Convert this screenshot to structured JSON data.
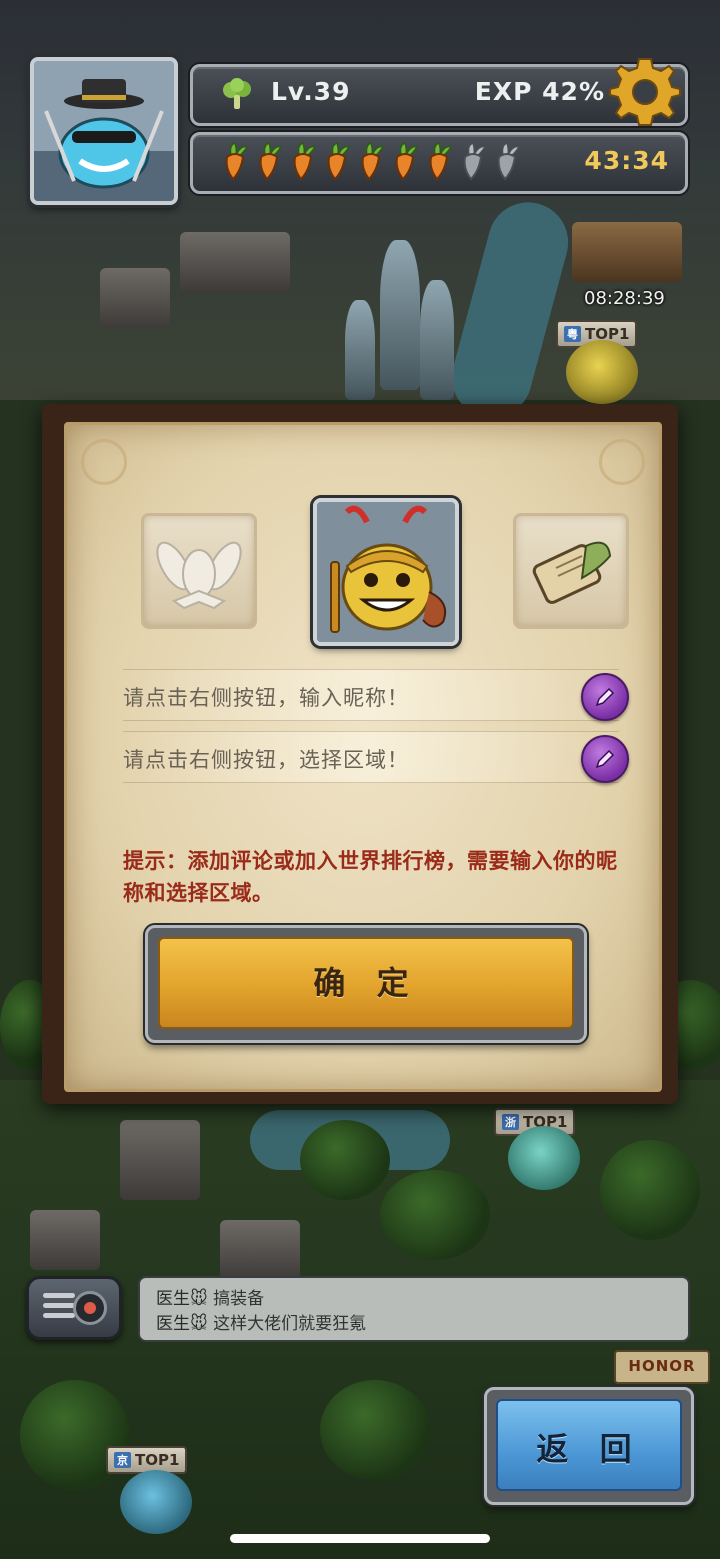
{
  "hud": {
    "level": "Lv.39",
    "exp": "EXP 42%",
    "stamina_full": 7,
    "stamina_total": 9,
    "timer": "43:34"
  },
  "map": {
    "event_timer": "08:28:39",
    "top_badges": [
      {
        "province": "粤",
        "label": "TOP1"
      },
      {
        "province": "浙",
        "label": "TOP1"
      },
      {
        "province": "京",
        "label": "TOP1"
      }
    ],
    "honor_label": "HONOR"
  },
  "dialog": {
    "nickname_prompt": "请点击右侧按钮，输入昵称！",
    "region_prompt": "请点击右侧按钮，选择区域！",
    "hint": "提示：添加评论或加入世界排行榜，需要输入你的昵称和选择区域。",
    "confirm_label": "确 定"
  },
  "chat": {
    "messages": [
      {
        "sender": "医生🐭",
        "text": "搞装备"
      },
      {
        "sender": "医生🐭",
        "text": "这样大佬们就要狂氪"
      }
    ]
  },
  "back_label": "返 回",
  "colors": {
    "confirm": "#e2a32c",
    "back": "#4c97d6",
    "hint": "#9a2a1a",
    "edit": "#7b2fa5",
    "timer": "#f1c85a"
  }
}
